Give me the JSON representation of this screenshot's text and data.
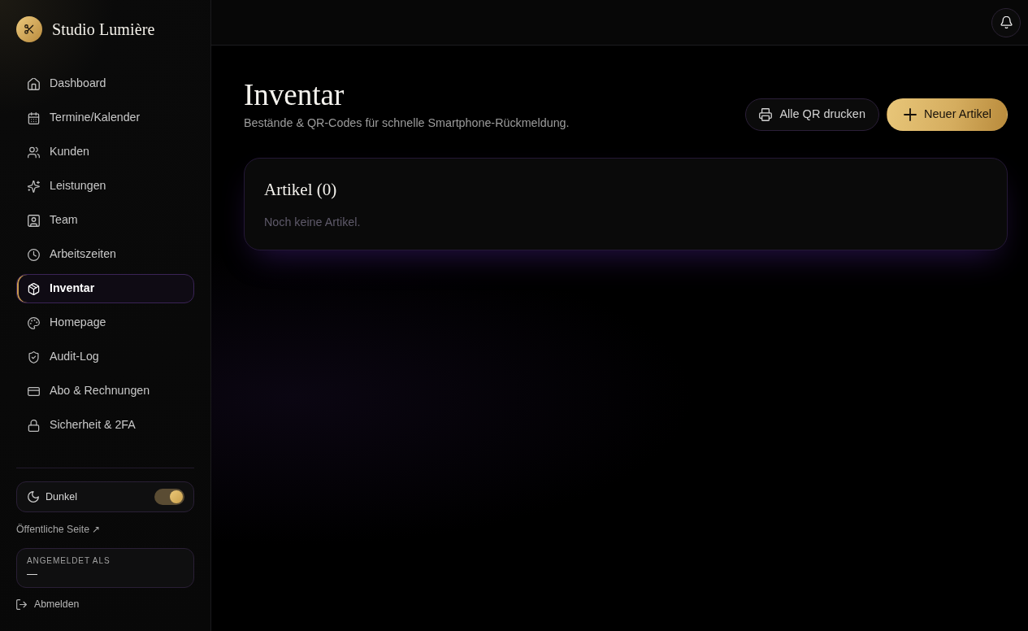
{
  "brand": {
    "name": "Studio Lumière"
  },
  "sidebar": {
    "items": [
      {
        "label": "Dashboard",
        "selected": false
      },
      {
        "label": "Termine/Kalender",
        "selected": false
      },
      {
        "label": "Kunden",
        "selected": false
      },
      {
        "label": "Leistungen",
        "selected": false
      },
      {
        "label": "Team",
        "selected": false
      },
      {
        "label": "Arbeitszeiten",
        "selected": false
      },
      {
        "label": "Inventar",
        "selected": true
      },
      {
        "label": "Homepage",
        "selected": false
      },
      {
        "label": "Audit-Log",
        "selected": false
      },
      {
        "label": "Abo & Rechnungen",
        "selected": false
      },
      {
        "label": "Sicherheit & 2FA",
        "selected": false
      }
    ],
    "theme_toggle": {
      "label": "Dunkel",
      "on": true
    },
    "public_link": "Öffentliche Seite ↗",
    "account": {
      "caption": "ANGEMELDET ALS",
      "value": "—"
    },
    "logout": "Abmelden"
  },
  "page": {
    "title": "Inventar",
    "subtitle": "Bestände & QR-Codes für schnelle Smartphone-Rückmeldung.",
    "actions": [
      {
        "label": "Alle QR drucken",
        "kind": "print"
      },
      {
        "label": "Neuer Artikel",
        "kind": "add"
      }
    ],
    "articles_card": {
      "title": "Artikel (0)",
      "empty_text": "Noch keine Artikel."
    }
  }
}
